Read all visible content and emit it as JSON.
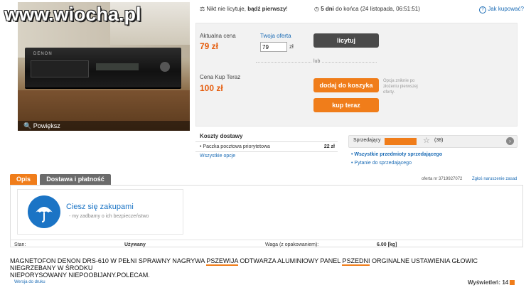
{
  "watermark": "www.wiocha.pl",
  "photo": {
    "caption": "Powiększ",
    "brand": "DENON"
  },
  "topbar": {
    "bids_prefix": "Nikt nie licytuje,",
    "bids_bold": "bądź pierwszy",
    "bids_suffix": "!",
    "time_bold": "5 dni",
    "time_rest": "do końca (24 listopada, 06:51:51)",
    "help_link": "Jak kupować?"
  },
  "buy": {
    "current_price_label": "Aktualna cena",
    "current_price": "79 zł",
    "your_offer_label": "Twoja oferta",
    "bid_value": "79",
    "bid_unit": "zł",
    "bid_button": "licytuj",
    "or_label": "lub",
    "buy_now_label": "Cena Kup Teraz",
    "buy_now_price": "100 zł",
    "add_to_cart": "dodaj do koszyka",
    "buy_now_button": "kup teraz",
    "note": "Opcja zniknie po złożeniu pierwszej oferty."
  },
  "shipping": {
    "title": "Koszty dostawy",
    "method": "Paczka pocztowa priorytetowa",
    "cost": "22 zł",
    "all_options": "Wszystkie opcje"
  },
  "seller": {
    "label": "Sprzedający",
    "rating": "(38)",
    "all_items": "Wszystkie przedmioty sprzedającego",
    "ask": "Pytanie do sprzedającego"
  },
  "tabs": {
    "description": "Opis",
    "delivery": "Dostawa i płatność"
  },
  "offer": {
    "number": "oferta nr 3719927072",
    "report": "Zgłoś naruszenie zasad"
  },
  "promo": {
    "title": "Ciesz się zakupami",
    "subtitle": "my zadbamy o ich bezpieczeństwo"
  },
  "details": {
    "state_label": "Stan:",
    "state_value": "Używany",
    "weight_label": "Waga (z opakowaniem):",
    "weight_value": "6.00 [kg]"
  },
  "description": {
    "p1": "MAGNETOFON DENON DRS-610 W PEŁNI SPRAWNY NAGRYWA ",
    "u1": "PSZEWIJA",
    "p2": " ODTWARZA ALUMINIOWY PANEL ",
    "u2": "PSZEDNI",
    "p3": " ORGINALNE USTAWIENIA GŁOWIC NIEGRZEBANY W ŚRODKU",
    "line2": "NIEPORYSOWANY NIEPOOBIJANY.POLECAM."
  },
  "footer": {
    "print": "Wersja do druku",
    "views_label": "Wyświetleń:",
    "views": "14"
  },
  "colors": {
    "accent": "#f07d1a",
    "price": "#e55c0c",
    "link": "#1a6bb5",
    "promo_icon": "#1b74c5"
  }
}
